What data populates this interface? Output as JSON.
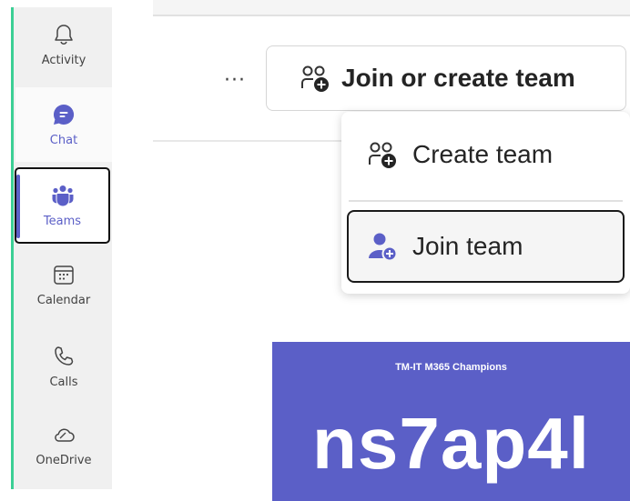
{
  "rail": {
    "items": [
      {
        "label": "Activity",
        "icon": "bell-icon"
      },
      {
        "label": "Chat",
        "icon": "chat-icon"
      },
      {
        "label": "Teams",
        "icon": "teams-icon"
      },
      {
        "label": "Calendar",
        "icon": "calendar-icon"
      },
      {
        "label": "Calls",
        "icon": "phone-icon"
      },
      {
        "label": "OneDrive",
        "icon": "cloud-icon"
      }
    ],
    "accent_color": "#5b5fc7",
    "edge_color": "#3ccf95"
  },
  "header": {
    "more_label": "···",
    "join_create_label": "Join or create team"
  },
  "menu": {
    "create_label": "Create team",
    "join_label": "Join team"
  },
  "card": {
    "title": "TM-IT M365 Champions",
    "code": "ns7ap4l",
    "color": "#5b5fc7"
  }
}
